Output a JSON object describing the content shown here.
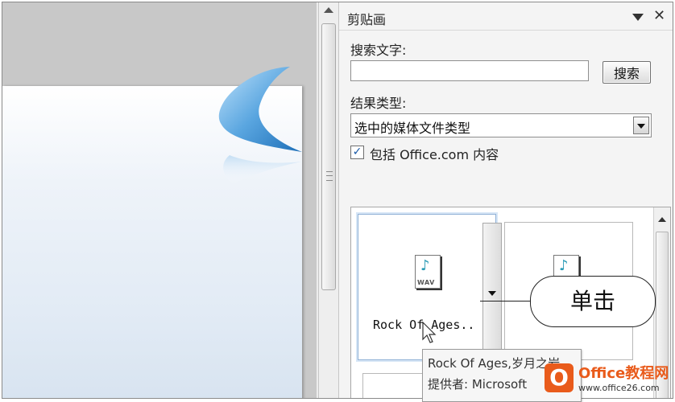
{
  "pane": {
    "title": "剪贴画",
    "search_label": "搜索文字:",
    "search_value": "",
    "search_button": "搜索",
    "result_type_label": "结果类型:",
    "result_type_value": "选中的媒体文件类型",
    "include_office": {
      "checked": true,
      "label": "包括 Office.com 内容"
    }
  },
  "gallery": {
    "items": [
      {
        "name": "Rock Of Ages..",
        "icon": "wav-audio-icon",
        "selected": true
      },
      {
        "name": "...",
        "icon": "wav-audio-icon",
        "selected": false
      }
    ]
  },
  "tooltip": {
    "line1": "Rock Of Ages,岁月之岩",
    "line2": "提供者: Microsoft"
  },
  "callout": {
    "text": "单击"
  },
  "watermark": {
    "logo_letter": "O",
    "title": "Office教程网",
    "url": "www.office26.com"
  },
  "colors": {
    "accent_blue": "#5aa6e0",
    "watermark_orange": "#e95b1b"
  }
}
